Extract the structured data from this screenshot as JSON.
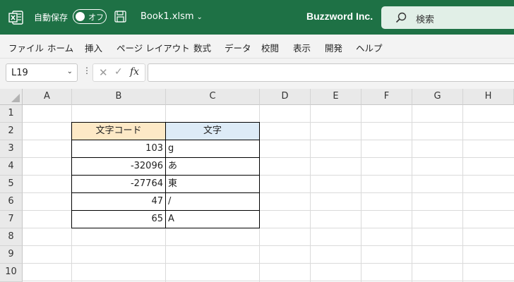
{
  "titlebar": {
    "autosave_label": "自動保存",
    "toggle_label": "オフ",
    "filename": "Book1.xlsm",
    "company": "Buzzword Inc.",
    "search_placeholder": "検索",
    "bg_color": "#1e7145"
  },
  "menu": [
    "ファイル",
    "ホーム",
    "挿入",
    "ページ レイアウト",
    "数式",
    "データ",
    "校閲",
    "表示",
    "開発",
    "ヘルプ"
  ],
  "formula_bar": {
    "name_box": "L19",
    "formula": ""
  },
  "sheet": {
    "columns": [
      "A",
      "B",
      "C",
      "D",
      "E",
      "F",
      "G",
      "H"
    ],
    "rows": [
      "1",
      "2",
      "3",
      "4",
      "5",
      "6",
      "7",
      "8",
      "9",
      "10"
    ],
    "table": {
      "header": [
        "文字コード",
        "文字"
      ],
      "header_colors": [
        "#fde9c6",
        "#ddebf7"
      ],
      "rows": [
        [
          "103",
          "g"
        ],
        [
          "-32096",
          "あ"
        ],
        [
          "-27764",
          "東"
        ],
        [
          "47",
          "/"
        ],
        [
          "65",
          "A"
        ]
      ]
    }
  }
}
